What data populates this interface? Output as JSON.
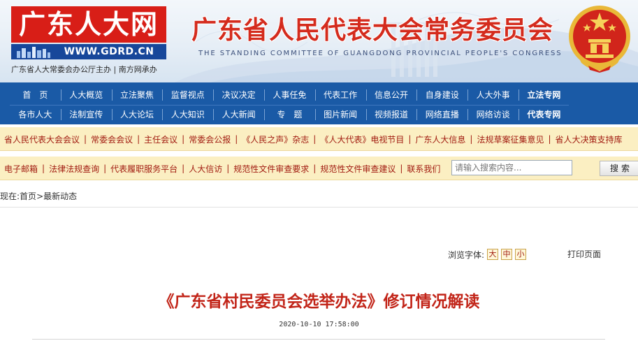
{
  "header": {
    "logo_text": "广东人大网",
    "logo_url": "WWW.GDRD.CN",
    "sponsor": "广东省人大常委会办公厅主办 | 南方网承办",
    "site_title": "广东省人民代表大会常务委员会",
    "site_subtitle": "THE STANDING COMMITTEE OF GUANGDONG PROVINCIAL PEOPLE'S CONGRESS"
  },
  "nav": {
    "row1": [
      "首　页",
      "人大概览",
      "立法聚焦",
      "监督视点",
      "决议决定",
      "人事任免",
      "代表工作",
      "信息公开",
      "自身建设",
      "人大外事",
      "立法专网"
    ],
    "row2": [
      "各市人大",
      "法制宣传",
      "人大论坛",
      "人大知识",
      "人大新闻",
      "专　题",
      "图片新闻",
      "视频报道",
      "网络直播",
      "网络访谈",
      "代表专网"
    ]
  },
  "quicklinks1": [
    "省人民代表大会会议",
    "常委会会议",
    "主任会议",
    "常委会公报",
    "《人民之声》杂志",
    "《人大代表》电视节目",
    "广东人大信息",
    "法规草案征集意见",
    "省人大决策支持库"
  ],
  "quicklinks2": [
    "电子邮箱",
    "法律法规查询",
    "代表履职服务平台",
    "人大信访",
    "规范性文件审查要求",
    "规范性文件审查建议",
    "联系我们"
  ],
  "search": {
    "placeholder": "请输入搜索内容...",
    "button": "搜索"
  },
  "breadcrumb": {
    "prefix": "现在:",
    "home": "首页",
    "sep": ">",
    "current": "最新动态"
  },
  "article": {
    "font_label": "浏览字体:",
    "font_large": "大",
    "font_medium": "中",
    "font_small": "小",
    "print": "打印页面",
    "title": "《广东省村民委员会选举办法》修订情况解读",
    "date": "2020-10-10 17:58:00"
  },
  "colors": {
    "nav_blue": "#1a5aa6",
    "logo_red": "#d81e17",
    "title_red": "#c22519",
    "bar_yellow": "#fbefc2"
  }
}
